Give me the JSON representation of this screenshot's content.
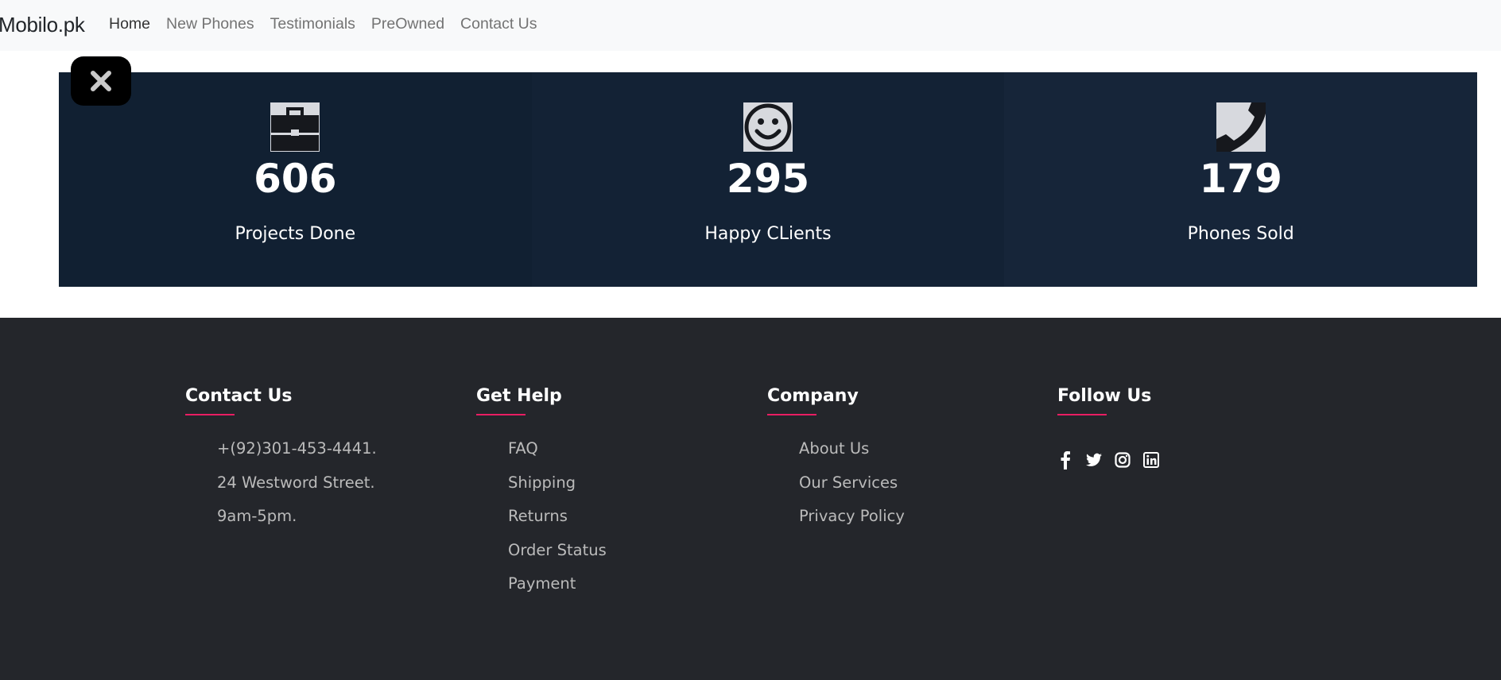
{
  "navbar": {
    "brand": "Mobilo.pk",
    "links": [
      "Home",
      "New Phones",
      "Testimonials",
      "PreOwned",
      "Contact Us"
    ]
  },
  "stats": [
    {
      "icon": "briefcase-icon",
      "value": "606",
      "label": "Projects Done"
    },
    {
      "icon": "smiley-icon",
      "value": "295",
      "label": "Happy CLients"
    },
    {
      "icon": "phone-icon",
      "value": "179",
      "label": "Phones Sold"
    }
  ],
  "footer": {
    "contact": {
      "title": "Contact Us",
      "items": [
        "+(92)301-453-4441.",
        "24 Westword Street.",
        "9am-5pm."
      ]
    },
    "help": {
      "title": "Get Help",
      "items": [
        "FAQ",
        "Shipping",
        "Returns",
        "Order Status",
        "Payment"
      ]
    },
    "company": {
      "title": "Company",
      "items": [
        "About Us",
        "Our Services",
        "Privacy Policy"
      ]
    },
    "follow": {
      "title": "Follow Us",
      "icons": [
        "facebook-icon",
        "twitter-icon",
        "instagram-icon",
        "linkedin-icon"
      ]
    }
  },
  "colors": {
    "accent": "#e91e63",
    "footer_bg": "#24262b",
    "stats_bg": "#132235"
  }
}
